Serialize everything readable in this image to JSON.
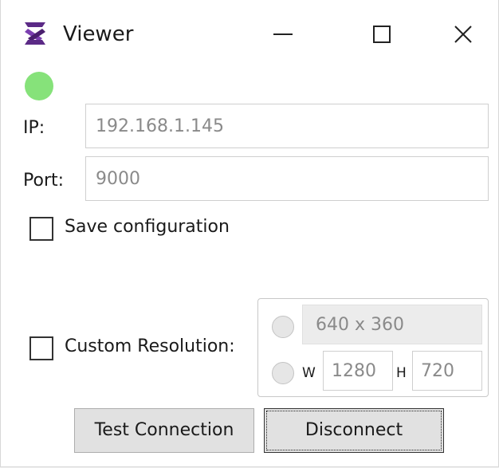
{
  "window": {
    "title": "Viewer",
    "status_color": "#86e27a"
  },
  "titlebar": {
    "app_icon": "crossed-sticks-icon",
    "minimize_icon": "minimize-icon",
    "maximize_icon": "maximize-icon",
    "close_icon": "close-icon"
  },
  "connection": {
    "ip_label": "IP:",
    "ip_value": "192.168.1.145",
    "port_label": "Port:",
    "port_value": "9000",
    "save_config_label": "Save configuration",
    "save_config_checked": false
  },
  "resolution": {
    "custom_label": "Custom Resolution:",
    "custom_checked": false,
    "preset_value": "640 x 360",
    "width_label": "W",
    "width_value": "1280",
    "height_label": "H",
    "height_value": "720"
  },
  "buttons": {
    "test_label": "Test Connection",
    "disconnect_label": "Disconnect"
  }
}
